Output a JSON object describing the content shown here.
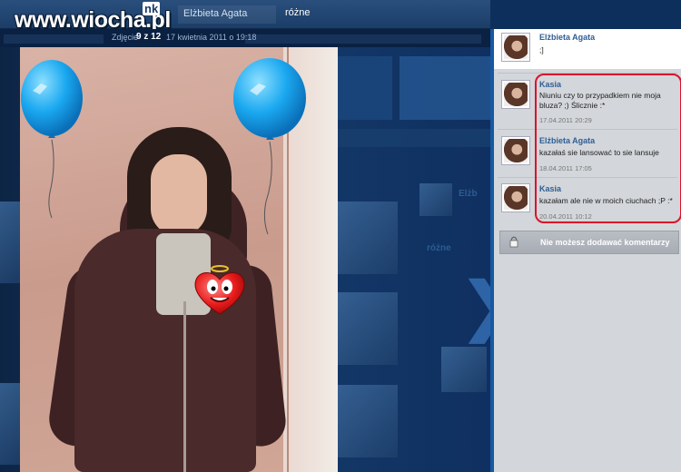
{
  "watermark": {
    "text": "www.wiocha.pl",
    "badge": "nk"
  },
  "nav": {
    "user": "Elżbieta Agata",
    "section": "różne"
  },
  "photo_meta": {
    "label": "Zdjęcie",
    "counter": "9 z 12",
    "date": "17 kwietnia 2011 o 19:18"
  },
  "background_profile": {
    "name": "Elżb",
    "album_title": "różne"
  },
  "comments": [
    {
      "author": "Elżbieta Agata",
      "text": ";]",
      "date": ""
    },
    {
      "author": "Kasia",
      "text": "Niuniu czy to przypadkiem nie moja bluza? ;) Ślicznie :*",
      "date": "17.04.2011 20:29"
    },
    {
      "author": "Elżbieta Agata",
      "text": "kazałaś sie lansować to sie lansuje",
      "date": "18.04.2011 17:05"
    },
    {
      "author": "Kasia",
      "text": "kazałam ale nie w moich ciuchach ;P :*",
      "date": "20.04.2011 10:12"
    }
  ],
  "no_comment_button": "Nie możesz dodawać komentarzy",
  "icons": [
    "lock-icon",
    "balloon-icon",
    "heart-emoticon-icon"
  ],
  "colors": {
    "accent": "#1659a3",
    "highlight": "#d9132b",
    "author": "#2d5e96",
    "balloon": "#1aa8f0"
  }
}
